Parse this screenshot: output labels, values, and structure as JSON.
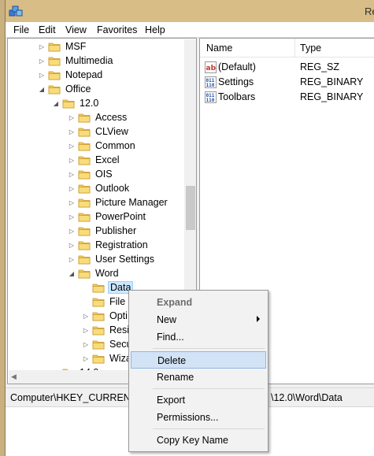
{
  "window": {
    "title": "Re"
  },
  "menubar": {
    "items": [
      "File",
      "Edit",
      "View",
      "Favorites",
      "Help"
    ]
  },
  "tree": {
    "rows": [
      {
        "label": "MSF",
        "expanded": false,
        "selected": false
      },
      {
        "label": "Multimedia",
        "expanded": false,
        "selected": false
      },
      {
        "label": "Notepad",
        "expanded": false,
        "selected": false
      },
      {
        "label": "Office",
        "expanded": true,
        "selected": false
      },
      {
        "label": "12.0",
        "expanded": true,
        "selected": false
      },
      {
        "label": "Access",
        "expanded": false,
        "selected": false
      },
      {
        "label": "CLView",
        "expanded": false,
        "selected": false
      },
      {
        "label": "Common",
        "expanded": false,
        "selected": false
      },
      {
        "label": "Excel",
        "expanded": false,
        "selected": false
      },
      {
        "label": "OIS",
        "expanded": false,
        "selected": false
      },
      {
        "label": "Outlook",
        "expanded": false,
        "selected": false
      },
      {
        "label": "Picture Manager",
        "expanded": false,
        "selected": false
      },
      {
        "label": "PowerPoint",
        "expanded": false,
        "selected": false
      },
      {
        "label": "Publisher",
        "expanded": false,
        "selected": false
      },
      {
        "label": "Registration",
        "expanded": false,
        "selected": false
      },
      {
        "label": "User Settings",
        "expanded": false,
        "selected": false
      },
      {
        "label": "Word",
        "expanded": true,
        "selected": false
      },
      {
        "label": "Data",
        "expanded": false,
        "selected": true
      },
      {
        "label": "File",
        "expanded": false,
        "selected": false
      },
      {
        "label": "Opti",
        "expanded": false,
        "selected": false
      },
      {
        "label": "Resi",
        "expanded": false,
        "selected": false
      },
      {
        "label": "Secu",
        "expanded": false,
        "selected": false
      },
      {
        "label": "Wiza",
        "expanded": false,
        "selected": false
      },
      {
        "label": "14.0",
        "expanded": false,
        "selected": false
      }
    ]
  },
  "list": {
    "columns": [
      "Name",
      "Type"
    ],
    "rows": [
      {
        "name": "(Default)",
        "type": "REG_SZ",
        "icon": "string-value-icon"
      },
      {
        "name": "Settings",
        "type": "REG_BINARY",
        "icon": "binary-value-icon"
      },
      {
        "name": "Toolbars",
        "type": "REG_BINARY",
        "icon": "binary-value-icon"
      }
    ]
  },
  "status": {
    "path_left": "Computer\\HKEY_CURRENT",
    "path_right": "\\12.0\\Word\\Data"
  },
  "context_menu": {
    "expand": "Expand",
    "new": "New",
    "find": "Find...",
    "delete": "Delete",
    "rename": "Rename",
    "export": "Export",
    "permissions": "Permissions...",
    "copy_key_name": "Copy Key Name"
  },
  "colors": {
    "titlebar": "#d8bd86",
    "selection": "#cce8ff",
    "menu_hover": "#d3e3f6"
  }
}
